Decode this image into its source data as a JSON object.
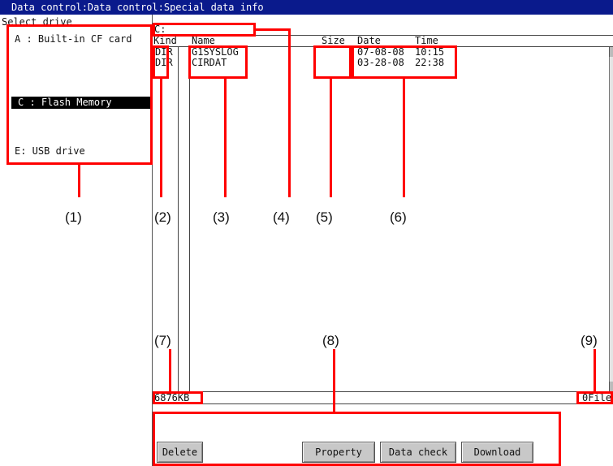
{
  "window": {
    "title": "Data control:Data control:Special data info"
  },
  "drive_panel": {
    "heading": "Select drive",
    "drives": [
      {
        "label": "A : Built-in CF card",
        "selected": false
      },
      {
        "label": "C : Flash Memory",
        "selected": true
      },
      {
        "label": "E: USB drive",
        "selected": false
      }
    ]
  },
  "file_list": {
    "path": "C:",
    "columns": {
      "kind": "Kind",
      "name": "Name",
      "size": "Size",
      "date": "Date",
      "time": "Time"
    },
    "rows": [
      {
        "kind": "DIR",
        "name": "G1SYSLOG",
        "size": "",
        "date": "07-08-08",
        "time": "10:15"
      },
      {
        "kind": "DIR",
        "name": "CIRDAT",
        "size": "",
        "date": "03-28-08",
        "time": "22:38"
      }
    ],
    "free_space": "6876KB",
    "file_count": "0File"
  },
  "buttons": {
    "delete": "Delete",
    "property": "Property",
    "data_check": "Data check",
    "download": "Download"
  },
  "callouts": {
    "c1": "(1)",
    "c2": "(2)",
    "c3": "(3)",
    "c4": "(4)",
    "c5": "(5)",
    "c6": "(6)",
    "c7": "(7)",
    "c8": "(8)",
    "c9": "(9)"
  },
  "colors": {
    "title_bar": "#0a1a8c",
    "annotation": "#ff0000",
    "button_face": "#c8c8c8",
    "selection": "#000000"
  }
}
